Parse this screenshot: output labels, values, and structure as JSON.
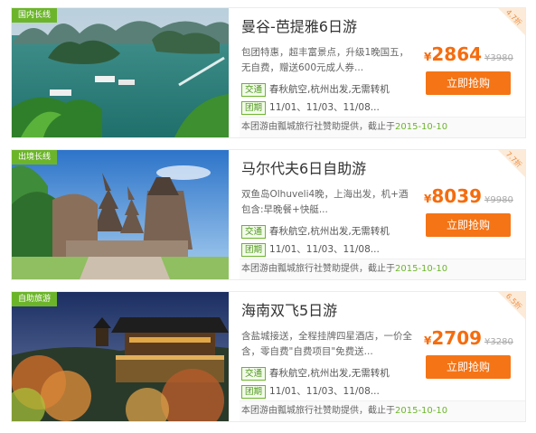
{
  "cards": [
    {
      "tag": "国内长线",
      "title": "曼谷-芭提雅6日游",
      "desc": "包团特惠，超丰富景点，升级1晚国五，无自费，赠送600元成人券...",
      "currency": "¥",
      "price": "2864",
      "old_price": "¥3980",
      "buy_label": "立即抢购",
      "transport_label": "交通",
      "transport": "春秋航空,杭州出发,无需转机",
      "period_label": "团期",
      "period": "11/01、11/03、11/08...",
      "footer_text": "本团游由瓢城旅行社赞助提供，截止于",
      "footer_date": "2015-10-10",
      "discount": "4.7折"
    },
    {
      "tag": "出境长线",
      "title": "马尔代夫6日自助游",
      "desc": "双鱼岛Olhuveli4晚，上海出发，机+酒包含:早晚餐+快艇...",
      "currency": "¥",
      "price": "8039",
      "old_price": "¥9980",
      "buy_label": "立即抢购",
      "transport_label": "交通",
      "transport": "春秋航空,杭州出发,无需转机",
      "period_label": "团期",
      "period": "11/01、11/03、11/08...",
      "footer_text": "本团游由瓢城旅行社赞助提供，截止于",
      "footer_date": "2015-10-10",
      "discount": "7.7折"
    },
    {
      "tag": "自助旅游",
      "title": "海南双飞5日游",
      "desc": "含盐城接送，全程挂牌四星酒店，一价全含，零自费\"自费项目\"免费送...",
      "currency": "¥",
      "price": "2709",
      "old_price": "¥3280",
      "buy_label": "立即抢购",
      "transport_label": "交通",
      "transport": "春秋航空,杭州出发,无需转机",
      "period_label": "团期",
      "period": "11/01、11/03、11/08...",
      "footer_text": "本团游由瓢城旅行社赞助提供，截止于",
      "footer_date": "2015-10-10",
      "discount": "6.5折"
    }
  ],
  "colors": {
    "accent": "#f57415",
    "green": "#6cb52b"
  }
}
